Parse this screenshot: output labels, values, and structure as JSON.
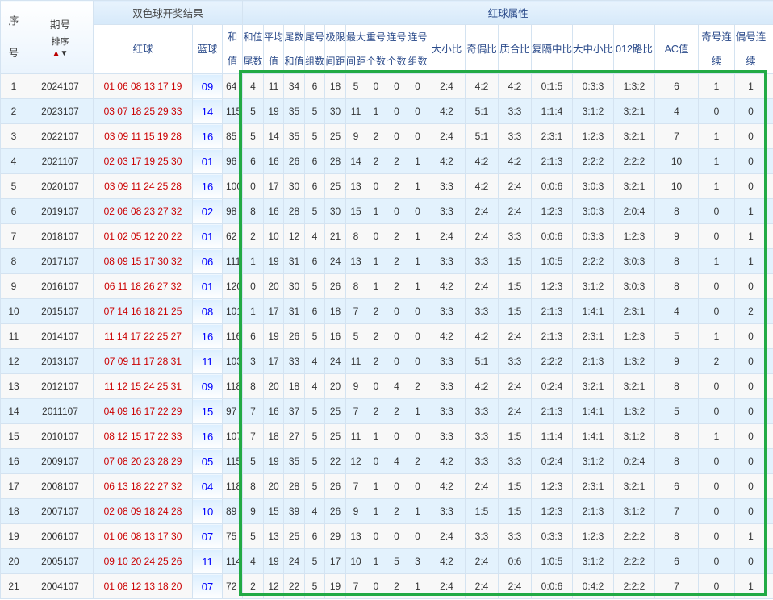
{
  "header": {
    "seq": "序号",
    "issue": "期号",
    "sort": "排序",
    "draw_result": "双色球开奖结果",
    "red_attr": "红球属性",
    "red": "红球",
    "blue": "蓝球",
    "sum": "和值",
    "cols": [
      "和值尾数",
      "平均值",
      "尾数和值",
      "尾号组数",
      "极限间距",
      "最大间距",
      "重号个数",
      "连号个数",
      "连号组数",
      "大小比",
      "奇偶比",
      "质合比",
      "复隔中比",
      "大中小比",
      "012路比",
      "AC值",
      "奇号连续",
      "偶号连续"
    ]
  },
  "rows": [
    [
      "1",
      "2024107",
      "01 06 08 13 17 19",
      "09",
      "64",
      "4",
      "11",
      "34",
      "6",
      "18",
      "5",
      "0",
      "0",
      "0",
      "2:4",
      "4:2",
      "4:2",
      "0:1:5",
      "0:3:3",
      "1:3:2",
      "6",
      "1",
      "1"
    ],
    [
      "2",
      "2023107",
      "03 07 18 25 29 33",
      "14",
      "115",
      "5",
      "19",
      "35",
      "5",
      "30",
      "11",
      "1",
      "0",
      "0",
      "4:2",
      "5:1",
      "3:3",
      "1:1:4",
      "3:1:2",
      "3:2:1",
      "4",
      "0",
      "0"
    ],
    [
      "3",
      "2022107",
      "03 09 11 15 19 28",
      "16",
      "85",
      "5",
      "14",
      "35",
      "5",
      "25",
      "9",
      "2",
      "0",
      "0",
      "2:4",
      "5:1",
      "3:3",
      "2:3:1",
      "1:2:3",
      "3:2:1",
      "7",
      "1",
      "0"
    ],
    [
      "4",
      "2021107",
      "02 03 17 19 25 30",
      "01",
      "96",
      "6",
      "16",
      "26",
      "6",
      "28",
      "14",
      "2",
      "2",
      "1",
      "4:2",
      "4:2",
      "4:2",
      "2:1:3",
      "2:2:2",
      "2:2:2",
      "10",
      "1",
      "0"
    ],
    [
      "5",
      "2020107",
      "03 09 11 24 25 28",
      "16",
      "100",
      "0",
      "17",
      "30",
      "6",
      "25",
      "13",
      "0",
      "2",
      "1",
      "3:3",
      "4:2",
      "2:4",
      "0:0:6",
      "3:0:3",
      "3:2:1",
      "10",
      "1",
      "0"
    ],
    [
      "6",
      "2019107",
      "02 06 08 23 27 32",
      "02",
      "98",
      "8",
      "16",
      "28",
      "5",
      "30",
      "15",
      "1",
      "0",
      "0",
      "3:3",
      "2:4",
      "2:4",
      "1:2:3",
      "3:0:3",
      "2:0:4",
      "8",
      "0",
      "1"
    ],
    [
      "7",
      "2018107",
      "01 02 05 12 20 22",
      "01",
      "62",
      "2",
      "10",
      "12",
      "4",
      "21",
      "8",
      "0",
      "2",
      "1",
      "2:4",
      "2:4",
      "3:3",
      "0:0:6",
      "0:3:3",
      "1:2:3",
      "9",
      "0",
      "1"
    ],
    [
      "8",
      "2017107",
      "08 09 15 17 30 32",
      "06",
      "111",
      "1",
      "19",
      "31",
      "6",
      "24",
      "13",
      "1",
      "2",
      "1",
      "3:3",
      "3:3",
      "1:5",
      "1:0:5",
      "2:2:2",
      "3:0:3",
      "8",
      "1",
      "1"
    ],
    [
      "9",
      "2016107",
      "06 11 18 26 27 32",
      "01",
      "120",
      "0",
      "20",
      "30",
      "5",
      "26",
      "8",
      "1",
      "2",
      "1",
      "4:2",
      "2:4",
      "1:5",
      "1:2:3",
      "3:1:2",
      "3:0:3",
      "8",
      "0",
      "0"
    ],
    [
      "10",
      "2015107",
      "07 14 16 18 21 25",
      "08",
      "101",
      "1",
      "17",
      "31",
      "6",
      "18",
      "7",
      "2",
      "0",
      "0",
      "3:3",
      "3:3",
      "1:5",
      "2:1:3",
      "1:4:1",
      "2:3:1",
      "4",
      "0",
      "2"
    ],
    [
      "11",
      "2014107",
      "11 14 17 22 25 27",
      "16",
      "116",
      "6",
      "19",
      "26",
      "5",
      "16",
      "5",
      "2",
      "0",
      "0",
      "4:2",
      "4:2",
      "2:4",
      "2:1:3",
      "2:3:1",
      "1:2:3",
      "5",
      "1",
      "0"
    ],
    [
      "12",
      "2013107",
      "07 09 11 17 28 31",
      "11",
      "103",
      "3",
      "17",
      "33",
      "4",
      "24",
      "11",
      "2",
      "0",
      "0",
      "3:3",
      "5:1",
      "3:3",
      "2:2:2",
      "2:1:3",
      "1:3:2",
      "9",
      "2",
      "0"
    ],
    [
      "13",
      "2012107",
      "11 12 15 24 25 31",
      "09",
      "118",
      "8",
      "20",
      "18",
      "4",
      "20",
      "9",
      "0",
      "4",
      "2",
      "3:3",
      "4:2",
      "2:4",
      "0:2:4",
      "3:2:1",
      "3:2:1",
      "8",
      "0",
      "0"
    ],
    [
      "14",
      "2011107",
      "04 09 16 17 22 29",
      "15",
      "97",
      "7",
      "16",
      "37",
      "5",
      "25",
      "7",
      "2",
      "2",
      "1",
      "3:3",
      "3:3",
      "2:4",
      "2:1:3",
      "1:4:1",
      "1:3:2",
      "5",
      "0",
      "0"
    ],
    [
      "15",
      "2010107",
      "08 12 15 17 22 33",
      "16",
      "107",
      "7",
      "18",
      "27",
      "5",
      "25",
      "11",
      "1",
      "0",
      "0",
      "3:3",
      "3:3",
      "1:5",
      "1:1:4",
      "1:4:1",
      "3:1:2",
      "8",
      "1",
      "0"
    ],
    [
      "16",
      "2009107",
      "07 08 20 23 28 29",
      "05",
      "115",
      "5",
      "19",
      "35",
      "5",
      "22",
      "12",
      "0",
      "4",
      "2",
      "4:2",
      "3:3",
      "3:3",
      "0:2:4",
      "3:1:2",
      "0:2:4",
      "8",
      "0",
      "0"
    ],
    [
      "17",
      "2008107",
      "06 13 18 22 27 32",
      "04",
      "118",
      "8",
      "20",
      "28",
      "5",
      "26",
      "7",
      "1",
      "0",
      "0",
      "4:2",
      "2:4",
      "1:5",
      "1:2:3",
      "2:3:1",
      "3:2:1",
      "6",
      "0",
      "0"
    ],
    [
      "18",
      "2007107",
      "02 08 09 18 24 28",
      "10",
      "89",
      "9",
      "15",
      "39",
      "4",
      "26",
      "9",
      "1",
      "2",
      "1",
      "3:3",
      "1:5",
      "1:5",
      "1:2:3",
      "2:1:3",
      "3:1:2",
      "7",
      "0",
      "0"
    ],
    [
      "19",
      "2006107",
      "01 06 08 13 17 30",
      "07",
      "75",
      "5",
      "13",
      "25",
      "6",
      "29",
      "13",
      "0",
      "0",
      "0",
      "2:4",
      "3:3",
      "3:3",
      "0:3:3",
      "1:2:3",
      "2:2:2",
      "8",
      "0",
      "1"
    ],
    [
      "20",
      "2005107",
      "09 10 20 24 25 26",
      "11",
      "114",
      "4",
      "19",
      "24",
      "5",
      "17",
      "10",
      "1",
      "5",
      "3",
      "4:2",
      "2:4",
      "0:6",
      "1:0:5",
      "3:1:2",
      "2:2:2",
      "6",
      "0",
      "0"
    ],
    [
      "21",
      "2004107",
      "01 08 12 13 18 20",
      "07",
      "72",
      "2",
      "12",
      "22",
      "5",
      "19",
      "7",
      "0",
      "2",
      "1",
      "2:4",
      "2:4",
      "2:4",
      "0:0:6",
      "0:4:2",
      "2:2:2",
      "7",
      "0",
      "1"
    ]
  ]
}
